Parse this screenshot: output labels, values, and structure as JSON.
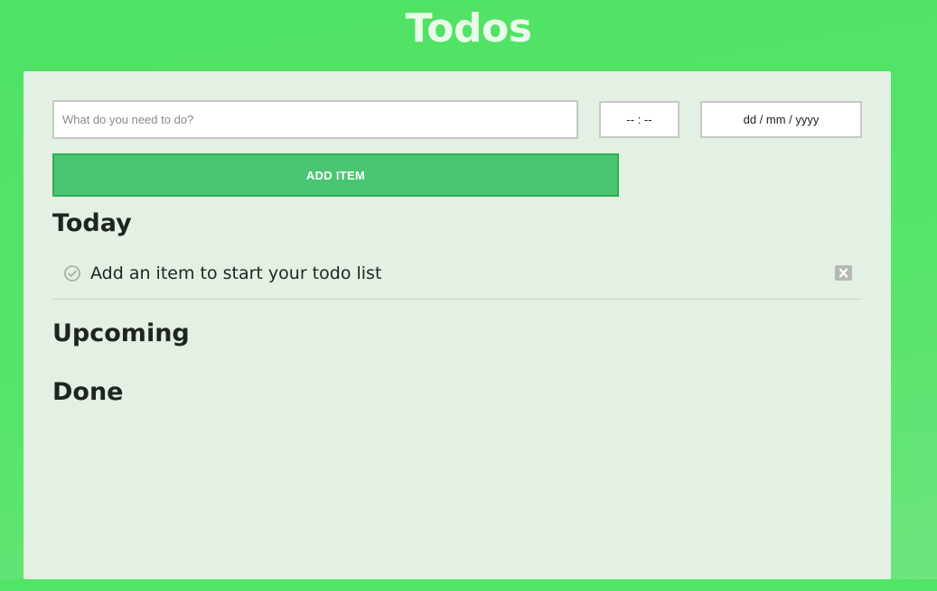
{
  "header": {
    "title": "Todos"
  },
  "form": {
    "todo_placeholder": "What do you need to do?",
    "time_placeholder": "-- : --",
    "date_placeholder": "dd / mm / yyyy",
    "add_label": "ADD ITEM"
  },
  "sections": {
    "today": "Today",
    "upcoming": "Upcoming",
    "done": "Done"
  },
  "today_items": [
    {
      "text": "Add an item to start your todo list",
      "icon": "check-circle-icon"
    }
  ],
  "icons": {
    "delete": "close-icon"
  },
  "colors": {
    "background": "#52e466",
    "card": "#e3f0e3",
    "button": "#4ac672",
    "title": "#e9fbe9"
  }
}
